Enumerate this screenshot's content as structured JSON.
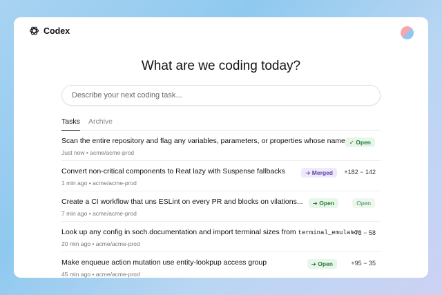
{
  "app": {
    "name": "Codex"
  },
  "main": {
    "heading": "What are we coding today?",
    "search_placeholder": "Describe your next coding task..."
  },
  "tabs": [
    {
      "label": "Tasks",
      "active": true
    },
    {
      "label": "Archive",
      "active": false
    }
  ],
  "tasks": [
    {
      "title": "Scan the entire repository and flag any variables, parameters, or properties whose names",
      "time": "Just now",
      "repo": "acme/acme-prod",
      "status_label": "✓ Open",
      "additions": "",
      "deletions": ""
    },
    {
      "title": "Convert non-critical components to Reat lazy with Suspense fallbacks",
      "time": "1 min ago",
      "repo": "acme/acme-prod",
      "status_label": "➔ Merged",
      "additions": "+182",
      "deletions": "− 142"
    },
    {
      "title": "Create a CI workflow that uns ESLint on every PR and blocks on vilations...",
      "time": "7 min ago",
      "repo": "acme/acme-prod",
      "status_label": "➔ Open",
      "secondary_label": "Open",
      "additions": "",
      "deletions": ""
    },
    {
      "title": "Look up any config in soch.documentation and import terminal sizes from",
      "title_code": "terminal_emulator",
      "time": "20 min ago",
      "repo": "acme/acme-prod",
      "additions": "+73",
      "deletions": "− 58"
    },
    {
      "title": "Make enqueue action mutation use entity-lookpup access group",
      "time": "45 min ago",
      "repo": "acme/acme-prod",
      "status_label": "➔ Open",
      "additions": "+95",
      "deletions": "− 35"
    }
  ],
  "colors": {
    "open_badge_bg": "#e8f6ea",
    "open_badge_text": "#217a35",
    "merged_badge_bg": "#efe9fb",
    "merged_badge_text": "#5b3ea5"
  },
  "icons": {
    "logo": "openai-knot-icon",
    "avatar": "user-avatar"
  }
}
